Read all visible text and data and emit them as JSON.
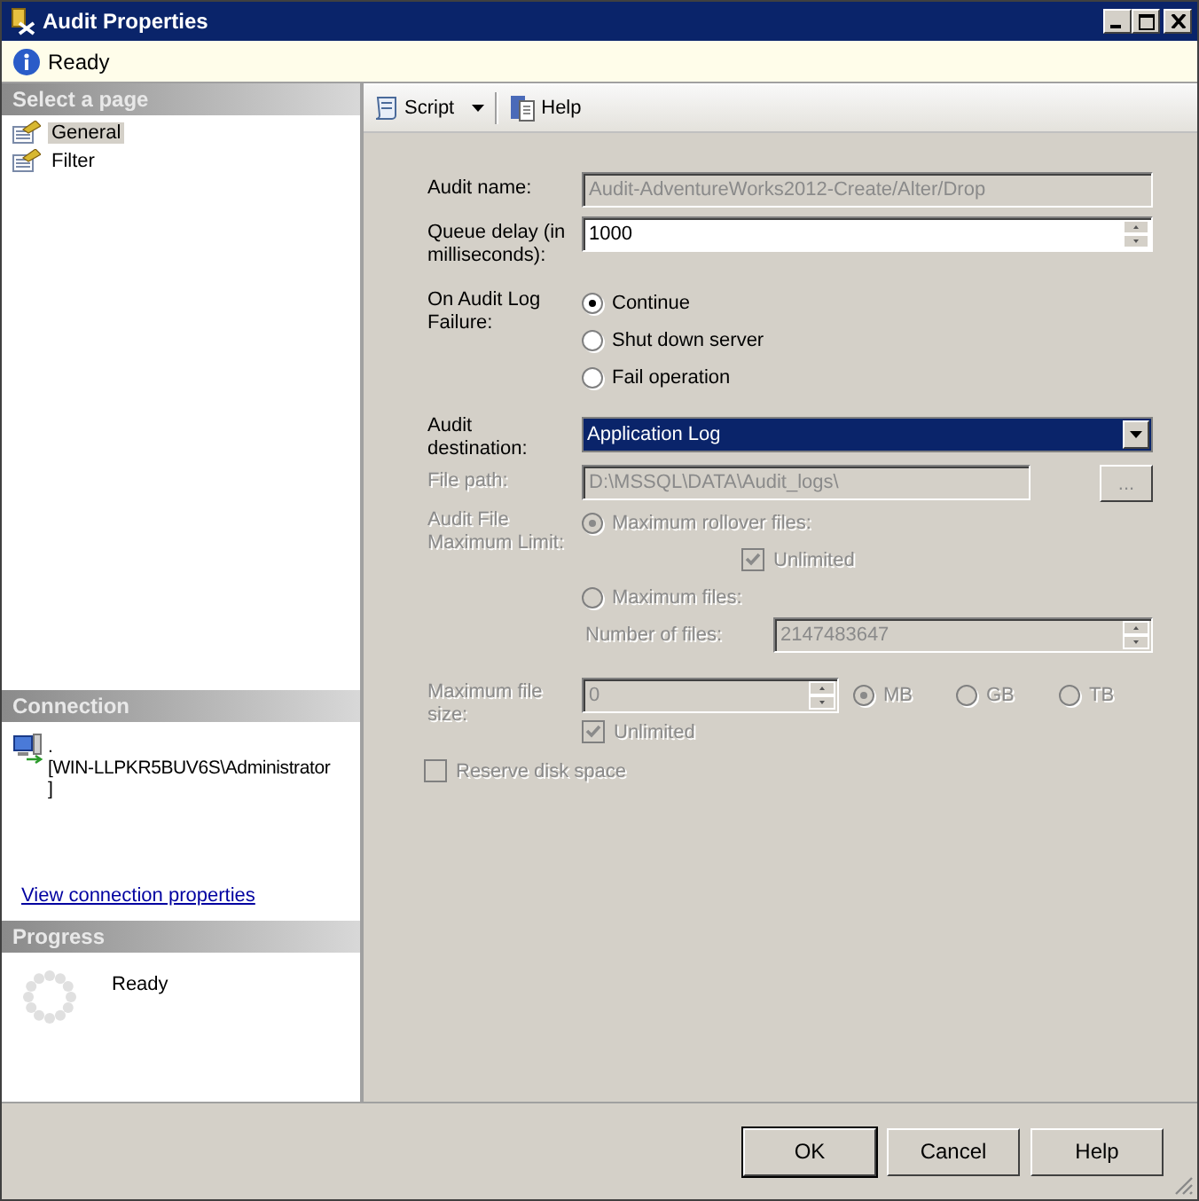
{
  "window": {
    "title": "Audit Properties"
  },
  "status": {
    "text": "Ready"
  },
  "sidebar": {
    "heading": "Select a page",
    "pages": [
      {
        "label": "General",
        "selected": true
      },
      {
        "label": "Filter",
        "selected": false
      }
    ]
  },
  "connection": {
    "heading": "Connection",
    "lines": [
      ".",
      "[WIN-LLPKR5BUV6S\\Administrator",
      "]"
    ],
    "link": "View connection properties"
  },
  "progress": {
    "heading": "Progress",
    "text": "Ready"
  },
  "toolbar": [
    {
      "label": "Script",
      "kind": "dropdown"
    },
    {
      "label": "Help",
      "kind": "button"
    }
  ],
  "form": {
    "audit_name": {
      "label": "Audit name:",
      "value": "Audit-AdventureWorks2012-Create/Alter/Drop",
      "disabled": true
    },
    "queue_delay": {
      "label": "Queue delay (in milliseconds):",
      "value": "1000"
    },
    "on_failure": {
      "label": "On Audit Log Failure:",
      "options": [
        {
          "label": "Continue",
          "selected": true
        },
        {
          "label": "Shut down server",
          "selected": false
        },
        {
          "label": "Fail operation",
          "selected": false
        }
      ]
    },
    "destination": {
      "label": "Audit destination:",
      "value": "Application Log"
    },
    "file_path": {
      "label": "File path:",
      "value": "D:\\MSSQL\\DATA\\Audit_logs\\",
      "browse": "...",
      "disabled": true
    },
    "file_limit": {
      "label": "Audit File Maximum Limit:",
      "disabled": true,
      "rollover": {
        "label": "Maximum rollover files:",
        "selected": true
      },
      "unlimited": {
        "label": "Unlimited",
        "checked": true
      },
      "max_files": {
        "label": "Maximum files:",
        "selected": false
      },
      "number_of_files": {
        "label": "Number of files:",
        "value": "2147483647"
      }
    },
    "max_file_size": {
      "label": "Maximum file size:",
      "value": "0",
      "disabled": true,
      "units": [
        {
          "label": "MB",
          "selected": true
        },
        {
          "label": "GB",
          "selected": false
        },
        {
          "label": "TB",
          "selected": false
        }
      ],
      "unlimited": {
        "label": "Unlimited",
        "checked": true
      }
    },
    "reserve_disk_space": {
      "label": "Reserve disk space",
      "checked": false,
      "disabled": true
    }
  },
  "buttons": [
    {
      "label": "OK",
      "default": true
    },
    {
      "label": "Cancel",
      "default": false
    },
    {
      "label": "Help",
      "default": false
    }
  ]
}
